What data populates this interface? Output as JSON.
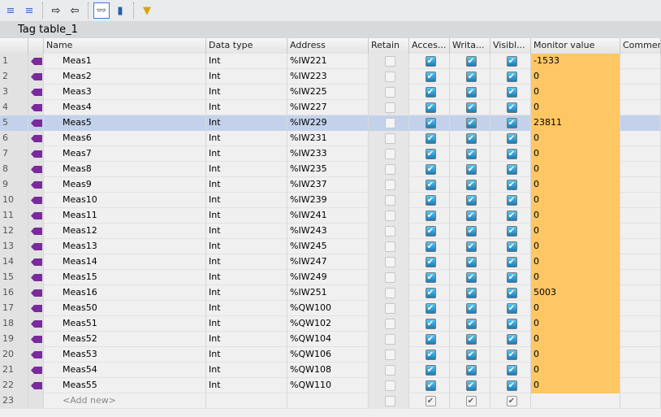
{
  "title": "Tag table_1",
  "toolbar": [
    {
      "icon": "add-row-icon"
    },
    {
      "icon": "insert-row-icon"
    },
    {
      "icon": "export-icon"
    },
    {
      "icon": "import-icon"
    },
    {
      "icon": "monitor-all-icon",
      "active": true
    },
    {
      "icon": "properties-icon"
    },
    {
      "icon": "filter-icon"
    }
  ],
  "headers": [
    "",
    "",
    "Name",
    "Data type",
    "Address",
    "Retain",
    "Acces...",
    "Writa...",
    "Visibl...",
    "Monitor value",
    "Commen"
  ],
  "rows": [
    [
      "1",
      "Meas1",
      "Int",
      "%IW221",
      "-1533"
    ],
    [
      "2",
      "Meas2",
      "Int",
      "%IW223",
      "0"
    ],
    [
      "3",
      "Meas3",
      "Int",
      "%IW225",
      "0"
    ],
    [
      "4",
      "Meas4",
      "Int",
      "%IW227",
      "0"
    ],
    [
      "5",
      "Meas5",
      "Int",
      "%IW229",
      "23811"
    ],
    [
      "6",
      "Meas6",
      "Int",
      "%IW231",
      "0"
    ],
    [
      "7",
      "Meas7",
      "Int",
      "%IW233",
      "0"
    ],
    [
      "8",
      "Meas8",
      "Int",
      "%IW235",
      "0"
    ],
    [
      "9",
      "Meas9",
      "Int",
      "%IW237",
      "0"
    ],
    [
      "10",
      "Meas10",
      "Int",
      "%IW239",
      "0"
    ],
    [
      "11",
      "Meas11",
      "Int",
      "%IW241",
      "0"
    ],
    [
      "12",
      "Meas12",
      "Int",
      "%IW243",
      "0"
    ],
    [
      "13",
      "Meas13",
      "Int",
      "%IW245",
      "0"
    ],
    [
      "14",
      "Meas14",
      "Int",
      "%IW247",
      "0"
    ],
    [
      "15",
      "Meas15",
      "Int",
      "%IW249",
      "0"
    ],
    [
      "16",
      "Meas16",
      "Int",
      "%IW251",
      "5003"
    ],
    [
      "17",
      "Meas50",
      "Int",
      "%QW100",
      "0"
    ],
    [
      "18",
      "Meas51",
      "Int",
      "%QW102",
      "0"
    ],
    [
      "19",
      "Meas52",
      "Int",
      "%QW104",
      "0"
    ],
    [
      "20",
      "Meas53",
      "Int",
      "%QW106",
      "0"
    ],
    [
      "21",
      "Meas54",
      "Int",
      "%QW108",
      "0"
    ],
    [
      "22",
      "Meas55",
      "Int",
      "%QW110",
      "0"
    ]
  ],
  "selected_row": 5,
  "add_new": {
    "num": "23",
    "label": "<Add new>"
  }
}
